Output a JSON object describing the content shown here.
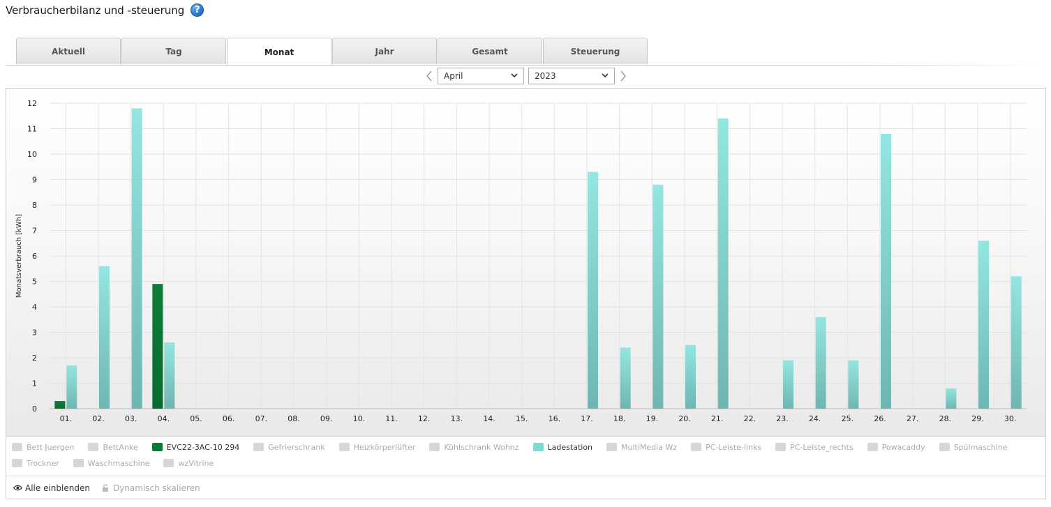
{
  "page": {
    "title": "Verbraucherbilanz und -steuerung",
    "help_icon": "?"
  },
  "tabs": [
    {
      "label": "Aktuell",
      "active": false
    },
    {
      "label": "Tag",
      "active": false
    },
    {
      "label": "Monat",
      "active": true
    },
    {
      "label": "Jahr",
      "active": false
    },
    {
      "label": "Gesamt",
      "active": false
    },
    {
      "label": "Steuerung",
      "active": false
    }
  ],
  "period": {
    "month": "April",
    "year": "2023"
  },
  "chart_data": {
    "type": "bar",
    "ylabel": "Monatsverbrauch [kWh]",
    "ylim": [
      0,
      12
    ],
    "yticks": [
      0,
      1,
      2,
      3,
      4,
      5,
      6,
      7,
      8,
      9,
      10,
      11,
      12
    ],
    "grid": true,
    "categories": [
      "01.",
      "02.",
      "03.",
      "04.",
      "05.",
      "06.",
      "07.",
      "08.",
      "09.",
      "10.",
      "11.",
      "12.",
      "13.",
      "14.",
      "15.",
      "16.",
      "17.",
      "18.",
      "19.",
      "20.",
      "21.",
      "22.",
      "23.",
      "24.",
      "25.",
      "26.",
      "27.",
      "28.",
      "29.",
      "30."
    ],
    "series": [
      {
        "name": "EVC22-3AC-10 294",
        "color": "#0c7a37",
        "values": [
          0.3,
          0,
          0,
          4.9,
          0,
          0,
          0,
          0,
          0,
          0,
          0,
          0,
          0,
          0,
          0,
          0,
          0,
          0,
          0,
          0,
          0,
          0,
          0,
          0,
          0,
          0,
          0,
          0,
          0,
          0
        ]
      },
      {
        "name": "Ladestation",
        "color": "#7fd8d2",
        "values": [
          1.7,
          5.6,
          11.8,
          2.6,
          0,
          0,
          0,
          0,
          0,
          0,
          0,
          0,
          0,
          0,
          0,
          0,
          9.3,
          2.4,
          8.8,
          2.5,
          11.4,
          0,
          1.9,
          3.6,
          1.9,
          10.8,
          0,
          0.8,
          6.6,
          5.2
        ]
      }
    ]
  },
  "legend": [
    {
      "label": "Bett Juergen",
      "on": false
    },
    {
      "label": "BettAnke",
      "on": false
    },
    {
      "label": "EVC22-3AC-10 294",
      "on": true,
      "color": "#0c7a37"
    },
    {
      "label": "Gefrierschrank",
      "on": false
    },
    {
      "label": "Heizkörperlüfter",
      "on": false
    },
    {
      "label": "Kühlschrank Wohnz",
      "on": false
    },
    {
      "label": "Ladestation",
      "on": true,
      "color": "#7fd8d2"
    },
    {
      "label": "MultiMedia Wz",
      "on": false
    },
    {
      "label": "PC-Leiste-links",
      "on": false
    },
    {
      "label": "PC-Leiste_rechts",
      "on": false
    },
    {
      "label": "Powacaddy",
      "on": false
    },
    {
      "label": "Spülmaschine",
      "on": false
    },
    {
      "label": "Trockner",
      "on": false
    },
    {
      "label": "Waschmaschine",
      "on": false
    },
    {
      "label": "wzVitrine",
      "on": false
    }
  ],
  "footer": {
    "show_all": "Alle einblenden",
    "dynamic_scale": "Dynamisch skalieren"
  }
}
